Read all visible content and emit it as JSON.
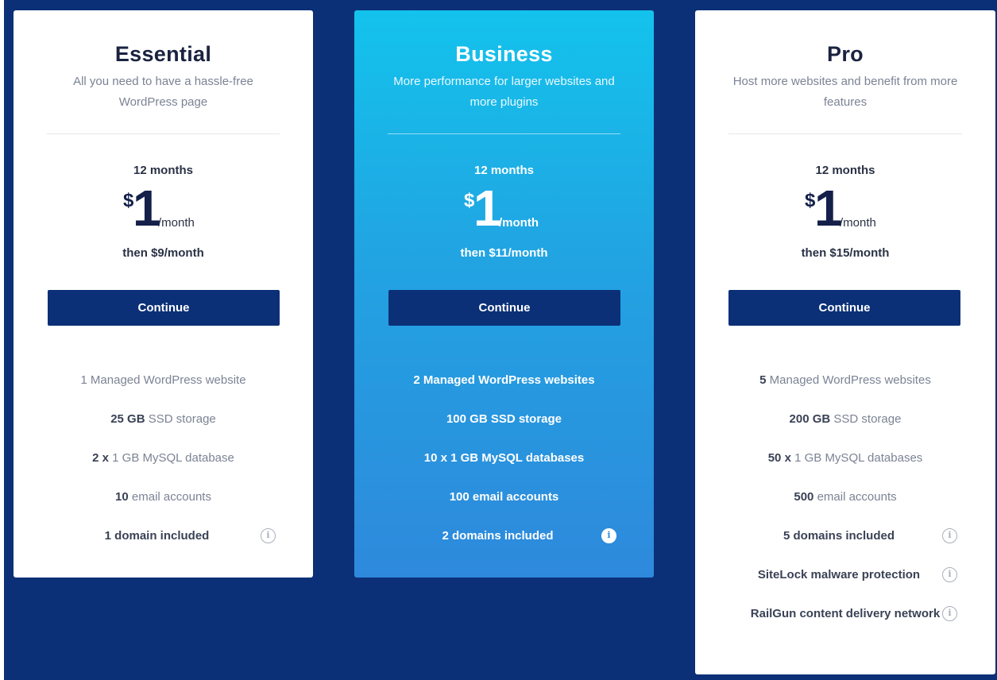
{
  "plans": [
    {
      "title": "Essential",
      "subtitle": "All you need to have a hassle-free WordPress page",
      "period": "12 months",
      "currency": "$",
      "amount": "1",
      "unit": "/month",
      "then": "then $9/month",
      "cta": "Continue",
      "features": [
        {
          "bold": "",
          "text": "1 Managed WordPress website"
        },
        {
          "bold": "25 GB",
          "text": " SSD storage"
        },
        {
          "bold": "2 x",
          "text": " 1 GB MySQL database"
        },
        {
          "bold": "10",
          "text": " email accounts"
        },
        {
          "bold": "1 domain included",
          "text": "",
          "info": true
        }
      ]
    },
    {
      "title": "Business",
      "subtitle": "More performance for larger websites and more plugins",
      "period": "12 months",
      "currency": "$",
      "amount": "1",
      "unit": "/month",
      "then": "then $11/month",
      "cta": "Continue",
      "features": [
        {
          "bold": "",
          "text": "2 Managed WordPress websites"
        },
        {
          "bold": "100 GB",
          "text": " SSD storage"
        },
        {
          "bold": "10 x",
          "text": " 1 GB MySQL databases"
        },
        {
          "bold": "100",
          "text": " email accounts"
        },
        {
          "bold": "2 domains included",
          "text": "",
          "info": true
        }
      ]
    },
    {
      "title": "Pro",
      "subtitle": "Host more websites and benefit from more features",
      "period": "12 months",
      "currency": "$",
      "amount": "1",
      "unit": "/month",
      "then": "then $15/month",
      "cta": "Continue",
      "features": [
        {
          "bold": "5",
          "text": " Managed WordPress websites"
        },
        {
          "bold": "200 GB",
          "text": " SSD storage"
        },
        {
          "bold": "50 x",
          "text": " 1 GB MySQL databases"
        },
        {
          "bold": "500",
          "text": " email accounts"
        },
        {
          "bold": "5 domains included",
          "text": "",
          "info": true
        },
        {
          "bold": "SiteLock malware protection",
          "text": "",
          "info": true
        },
        {
          "bold": "RailGun content delivery network",
          "text": "",
          "info": true
        }
      ]
    }
  ],
  "info_glyph": "i",
  "colors": {
    "background": "#0b3077",
    "button": "#0b3077",
    "business_gradient_top": "#13c3ec",
    "business_gradient_bottom": "#2e89dc"
  }
}
